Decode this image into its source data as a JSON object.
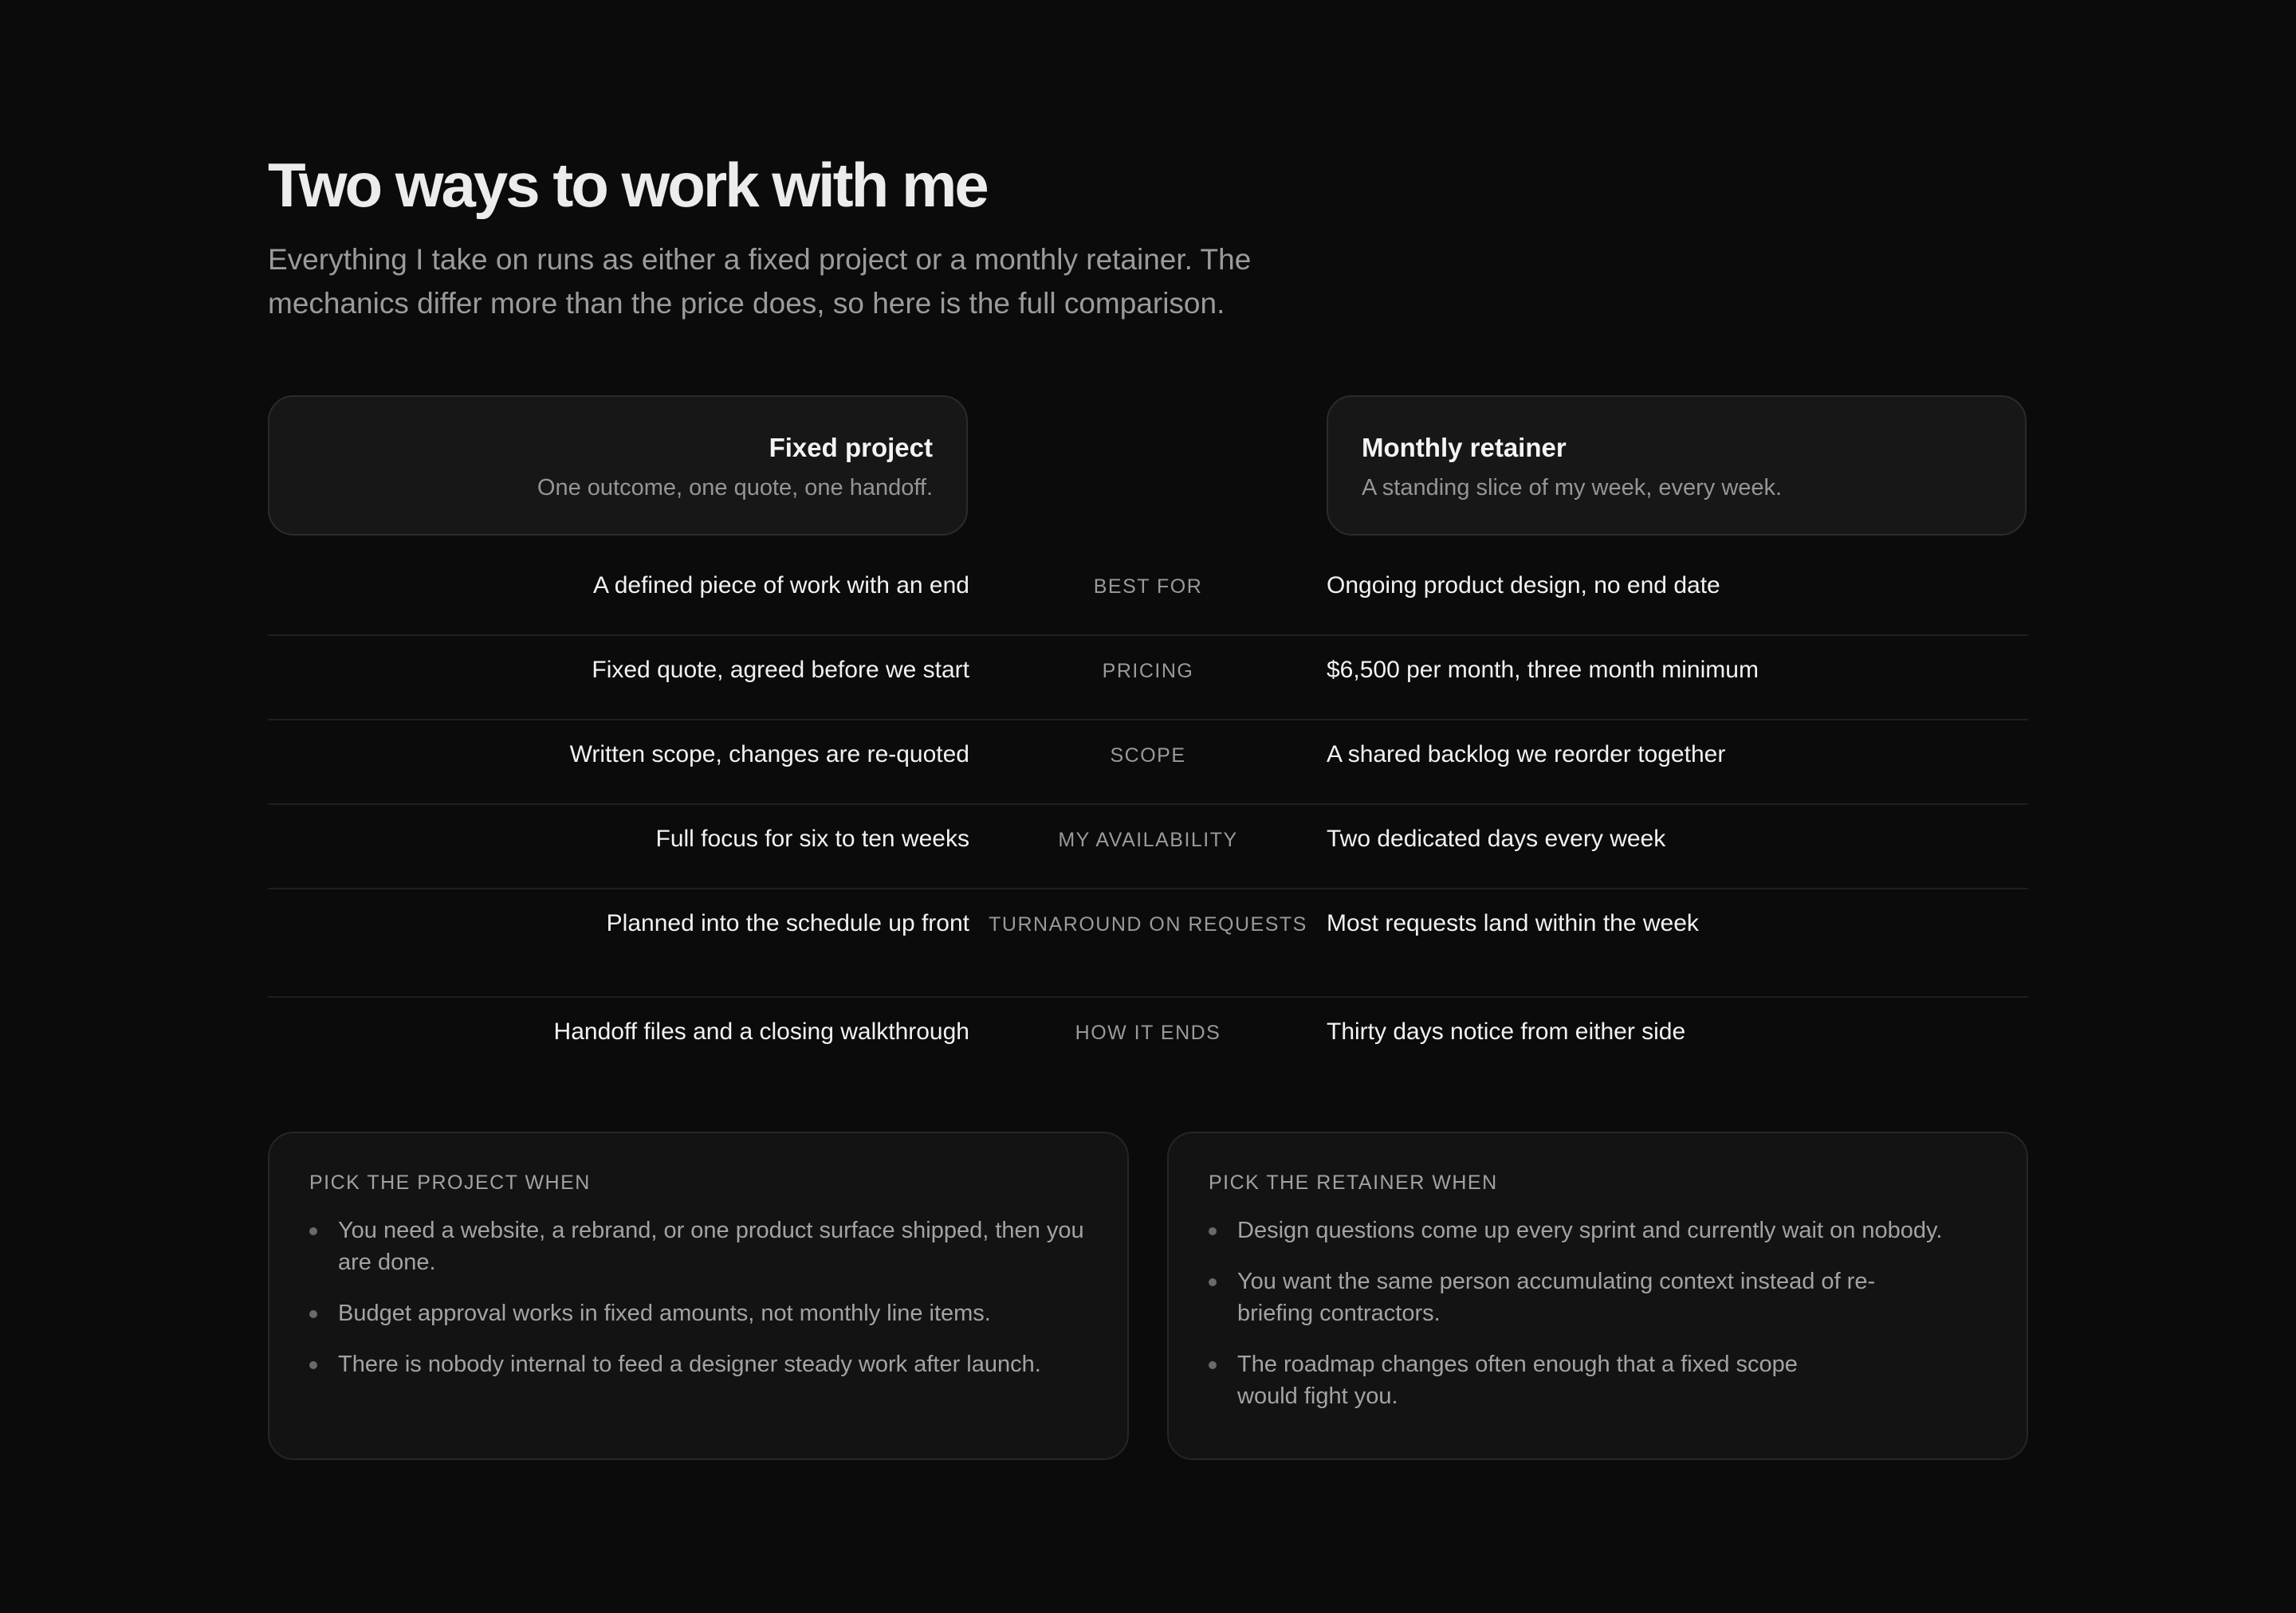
{
  "header": {
    "title": "Two ways to work with me",
    "intro": "Everything I take on runs as either a fixed project or a monthly retainer. The mechanics differ more than the price does, so here is the full comparison."
  },
  "plans": {
    "project": {
      "name": "Fixed project",
      "description": "One outcome, one quote, one handoff."
    },
    "retainer": {
      "name": "Monthly retainer",
      "description": "A standing slice of my week, every week."
    }
  },
  "comparison": [
    {
      "label": "BEST FOR",
      "project": "A defined piece of work with an end",
      "retainer": "Ongoing product design, no end date"
    },
    {
      "label": "PRICING",
      "project": "Fixed quote, agreed before we start",
      "retainer": "$6,500 per month, three month minimum"
    },
    {
      "label": "SCOPE",
      "project": "Written scope, changes are re-quoted",
      "retainer": "A shared backlog we reorder together"
    },
    {
      "label": "MY AVAILABILITY",
      "project": "Full focus for six to ten weeks",
      "retainer": "Two dedicated days every week"
    },
    {
      "label": "TURNAROUND ON REQUESTS",
      "project": "Planned into the schedule up front",
      "retainer": "Most requests land within the week"
    },
    {
      "label": "HOW IT ENDS",
      "project": "Handoff files and a closing walkthrough",
      "retainer": "Thirty days notice from either side"
    }
  ],
  "guidance": {
    "project": {
      "heading": "PICK THE PROJECT WHEN",
      "items": [
        "You need a website, a rebrand, or one product surface shipped, then you are done.",
        "Budget approval works in fixed amounts, not monthly line items.",
        "There is nobody internal to feed a designer steady work after launch."
      ]
    },
    "retainer": {
      "heading": "PICK THE RETAINER WHEN",
      "items": [
        "Design questions come up every sprint and currently wait on nobody.",
        "You want the same person accumulating context instead of re-briefing contractors.",
        "The roadmap changes often enough that a fixed scope would fight you."
      ]
    }
  }
}
